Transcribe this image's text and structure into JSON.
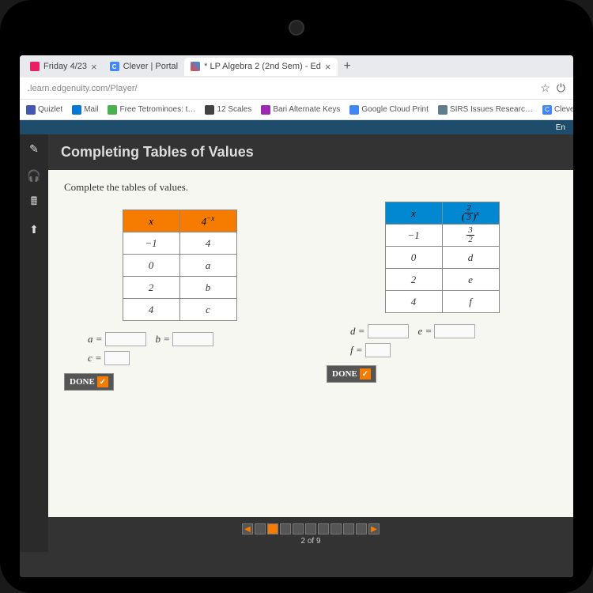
{
  "tabs": [
    {
      "label": "Friday 4/23",
      "icon": "pink"
    },
    {
      "label": "Clever | Portal",
      "icon": "C"
    },
    {
      "label": "* LP Algebra 2 (2nd Sem) - Ed",
      "icon": "edg",
      "active": true
    }
  ],
  "new_tab": "+",
  "url": ".learn.edgenuity.com/Player/",
  "star": "☆",
  "power": "⏻",
  "bookmarks": [
    {
      "label": "Quizlet",
      "color": "#4257b2"
    },
    {
      "label": "Mail",
      "color": "#0078d4"
    },
    {
      "label": "Free Tetrominoes: t…",
      "color": "#4caf50"
    },
    {
      "label": "12 Scales",
      "color": "#424242"
    },
    {
      "label": "Bari Alternate Keys",
      "color": "#9c27b0"
    },
    {
      "label": "Google Cloud Print",
      "color": "#4285f4"
    },
    {
      "label": "SIRS Issues Researc…",
      "color": "#607d8b"
    },
    {
      "label": "Clever | Portal",
      "color": "#4285f4"
    }
  ],
  "app_top_right": "En",
  "sidebar_icons": [
    "✎",
    "🎧",
    "🖩",
    "⬆"
  ],
  "lesson": {
    "title": "Completing Tables of Values",
    "prompt": "Complete the tables of values."
  },
  "table1": {
    "h1": "x",
    "h2_base": "4",
    "h2_exp": "−x",
    "rows": [
      {
        "x": "−1",
        "y": "4"
      },
      {
        "x": "0",
        "y": "a"
      },
      {
        "x": "2",
        "y": "b"
      },
      {
        "x": "4",
        "y": "c"
      }
    ]
  },
  "table2": {
    "h1": "x",
    "h2_frac_n": "2",
    "h2_frac_d": "3",
    "h2_exp": "x",
    "rows": [
      {
        "x": "−1",
        "y_frac_n": "3",
        "y_frac_d": "2"
      },
      {
        "x": "0",
        "y": "d"
      },
      {
        "x": "2",
        "y": "e"
      },
      {
        "x": "4",
        "y": "f"
      }
    ]
  },
  "inputs1": [
    {
      "label": "a ="
    },
    {
      "label": "b ="
    },
    {
      "label": "c ="
    }
  ],
  "inputs2": [
    {
      "label": "d ="
    },
    {
      "label": "e ="
    },
    {
      "label": "f ="
    }
  ],
  "done": "DONE",
  "pager": {
    "total": 9,
    "current": 2,
    "text": "2 of 9",
    "left": "◀",
    "right": "▶"
  }
}
